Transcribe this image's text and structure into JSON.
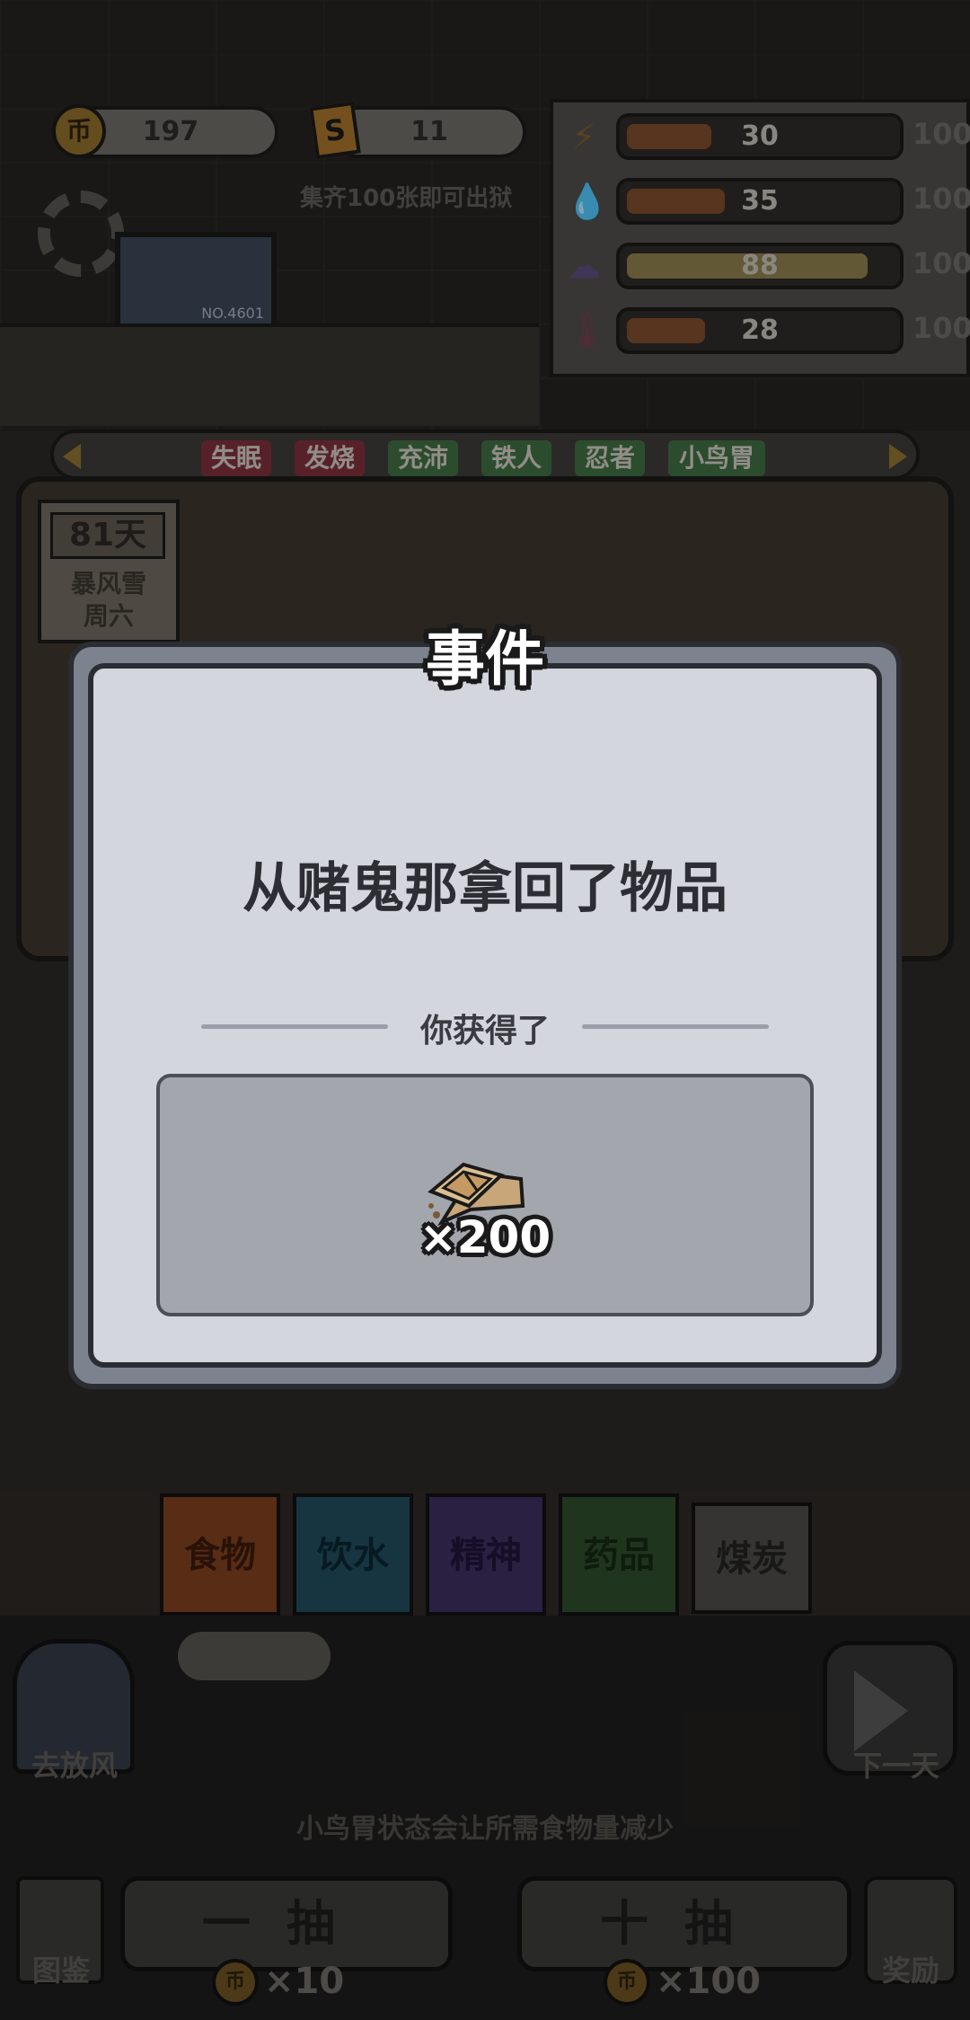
{
  "hud": {
    "coins": "197",
    "coin_symbol": "币",
    "tickets": "11",
    "ticket_symbol": "S",
    "ticket_hint": "集齐100张即可出狱"
  },
  "stats": [
    {
      "icon": "lightning-icon",
      "glyph": "⚡",
      "value": "30",
      "max": "100",
      "fill": 0.3
    },
    {
      "icon": "water-drop-icon",
      "glyph": "💧",
      "value": "35",
      "max": "100",
      "fill": 0.35
    },
    {
      "icon": "brain-icon",
      "glyph": "☁",
      "value": "88",
      "max": "100",
      "fill": 0.88
    },
    {
      "icon": "thermometer-icon",
      "glyph": "🌡",
      "value": "28",
      "max": "100",
      "fill": 0.28
    }
  ],
  "monitor": {
    "label": "NO.4601"
  },
  "traits": [
    {
      "label": "失眠",
      "color": "red"
    },
    {
      "label": "发烧",
      "color": "red"
    },
    {
      "label": "充沛",
      "color": "green"
    },
    {
      "label": "铁人",
      "color": "green"
    },
    {
      "label": "忍者",
      "color": "green"
    },
    {
      "label": "小鸟胃",
      "color": "green"
    }
  ],
  "day_card": {
    "days": "81天",
    "weather_line1": "暴风雪",
    "weather_line2": "周六"
  },
  "resources": {
    "food": "食物",
    "water": "饮水",
    "spirit": "精神",
    "medicine": "药品",
    "coal": "煤炭"
  },
  "actions": {
    "go_out": "去放风",
    "next_day": "下一天",
    "tip": "小鸟胃状态会让所需食物量减少",
    "draw_one": "一抽",
    "draw_ten": "十抽",
    "draw_one_cost": "×10",
    "draw_ten_cost": "×100",
    "gallery": "图鉴",
    "reward": "奖励"
  },
  "dialog": {
    "title": "事件",
    "event_text": "从赌鬼那拿回了物品",
    "reward_label": "你获得了",
    "reward_item_icon": "bread-icon",
    "reward_qty": "×200"
  },
  "colors": {
    "dialog_bg": "#d4d6de",
    "dialog_frame": "#7c828e",
    "reward_box": "#a4a6ad"
  }
}
